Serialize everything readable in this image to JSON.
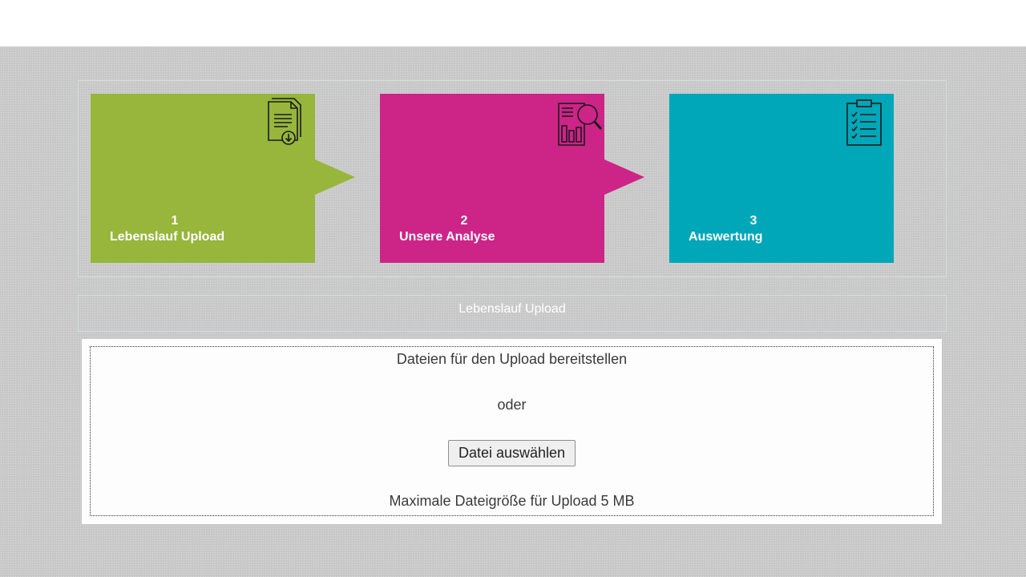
{
  "steps": [
    {
      "number": "1",
      "label": "Lebenslauf Upload",
      "color": "#97b63b",
      "icon": "document-download-icon"
    },
    {
      "number": "2",
      "label": "Unsere Analyse",
      "color": "#cd2488",
      "icon": "report-magnifier-icon"
    },
    {
      "number": "3",
      "label": "Auswertung",
      "color": "#00a7b9",
      "icon": "clipboard-checklist-icon"
    }
  ],
  "section_title": "Lebenslauf Upload",
  "dropzone": {
    "prompt": "Dateien für den Upload bereitstellen",
    "or_text": "oder",
    "button_label": "Datei auswählen",
    "max_size_text": "Maximale Dateigröße für Upload 5 MB"
  }
}
